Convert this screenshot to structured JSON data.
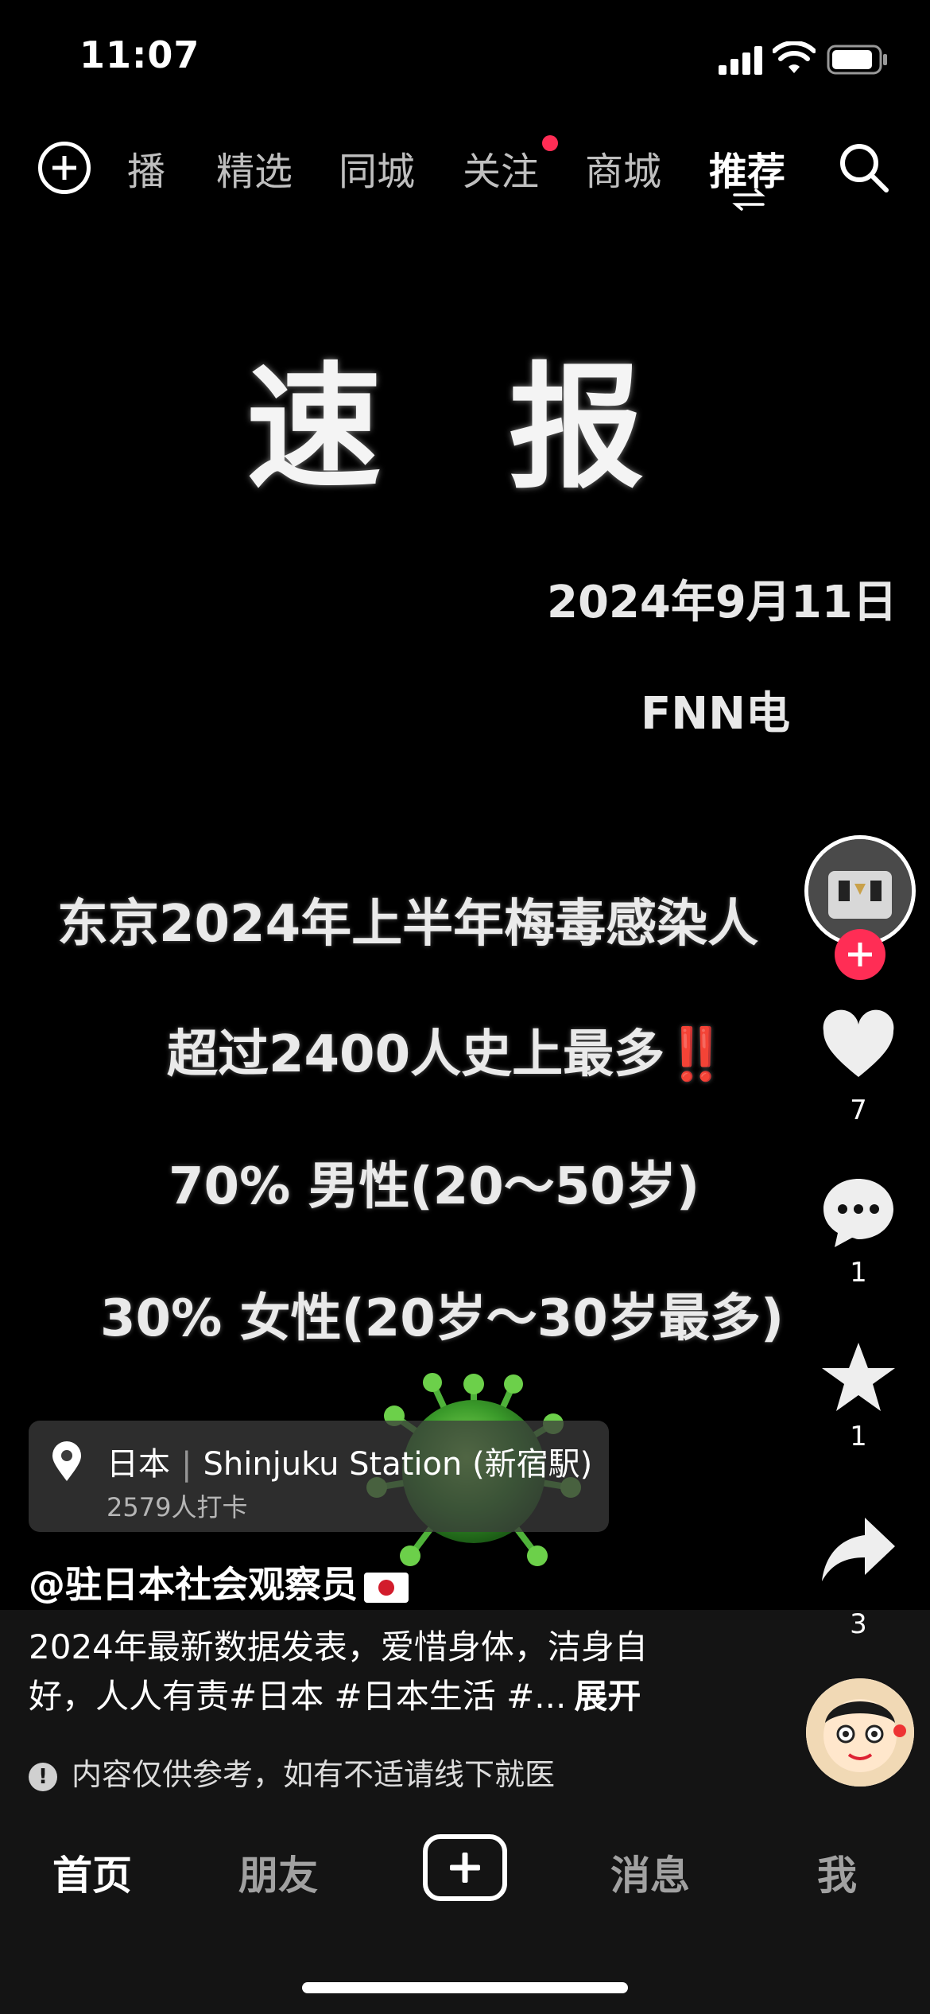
{
  "status_bar": {
    "time": "11:07"
  },
  "top_nav": {
    "tabs": [
      {
        "label": "播",
        "active": false
      },
      {
        "label": "精选",
        "active": false
      },
      {
        "label": "同城",
        "active": false
      },
      {
        "label": "关注",
        "active": false,
        "has_dot": true
      },
      {
        "label": "商城",
        "active": false
      },
      {
        "label": "推荐",
        "active": true
      }
    ]
  },
  "video": {
    "headline": "速报",
    "date": "2024年9月11日",
    "source": "FNN电",
    "lines": [
      "东京2024年上半年梅毒感染人",
      "超过2400人史上最多‼️",
      "70%  男性(20～50岁)",
      "30%  女性(20岁～30岁最多)"
    ]
  },
  "location": {
    "region": "日本",
    "place": "Shinjuku Station (新宿駅)",
    "checkins": "2579人打卡"
  },
  "author": {
    "handle": "@驻日本社会观察员"
  },
  "description": {
    "text": "2024年最新数据发表，爱惜身体，洁身自好，人人有责#日本 #日本生活 #...",
    "expand": "展开"
  },
  "notice": "内容仅供参考，如有不适请线下就医",
  "actions": {
    "likes": "7",
    "comments": "1",
    "favorites": "1",
    "shares": "3"
  },
  "bottom_nav": {
    "home": "首页",
    "friends": "朋友",
    "messages": "消息",
    "me": "我"
  },
  "colors": {
    "accent": "#ff2d55",
    "background": "#000000",
    "panel": "#141414"
  }
}
